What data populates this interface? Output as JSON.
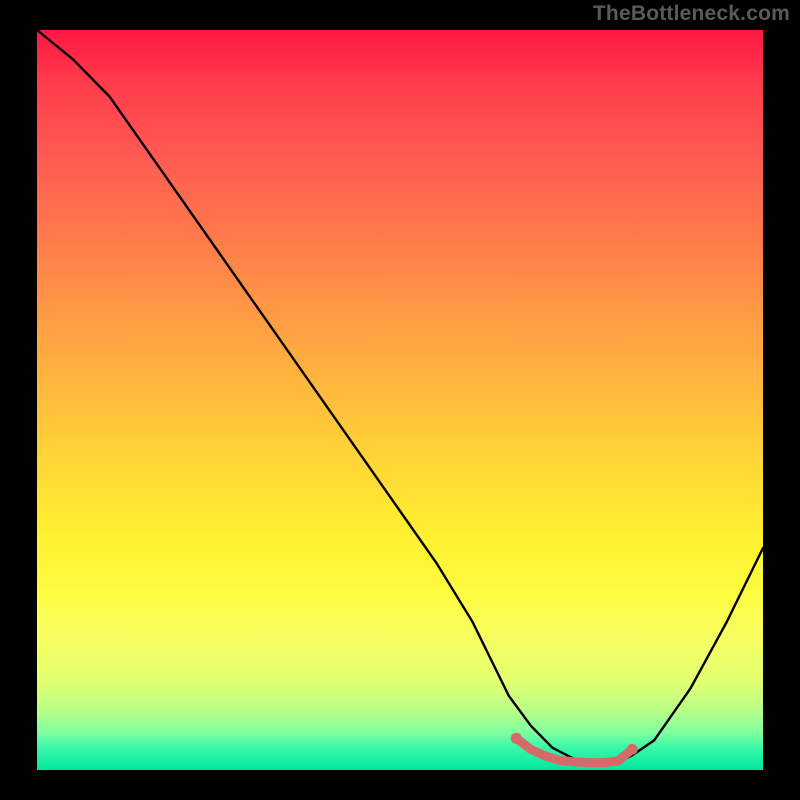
{
  "watermark": "TheBottleneck.com",
  "colors": {
    "page_bg": "#000000",
    "gradient_top": "#ff1744",
    "gradient_bottom": "#00e6a0",
    "curve_stroke": "#000000",
    "marker_stroke": "#d46a6a",
    "marker_fill": "#d46a6a"
  },
  "chart_data": {
    "type": "line",
    "title": "",
    "xlabel": "",
    "ylabel": "",
    "xlim": [
      0,
      100
    ],
    "ylim": [
      0,
      100
    ],
    "grid": false,
    "legend": false,
    "series": [
      {
        "name": "bottleneck-curve",
        "x": [
          0,
          5,
          10,
          15,
          20,
          25,
          30,
          35,
          40,
          45,
          50,
          55,
          60,
          62,
          65,
          68,
          71,
          74,
          77,
          80,
          82,
          85,
          90,
          95,
          100
        ],
        "y": [
          100,
          96,
          91,
          84,
          77,
          70,
          63,
          56,
          49,
          42,
          35,
          28,
          20,
          16,
          10,
          6,
          3,
          1.5,
          1,
          1,
          2,
          4,
          11,
          20,
          30
        ]
      }
    ],
    "markers": {
      "name": "optimal-range",
      "x": [
        66,
        68,
        70,
        72,
        74,
        76,
        78,
        80,
        82
      ],
      "y": [
        4.3,
        2.8,
        1.9,
        1.3,
        1.1,
        1.0,
        1.0,
        1.2,
        2.8
      ]
    }
  }
}
